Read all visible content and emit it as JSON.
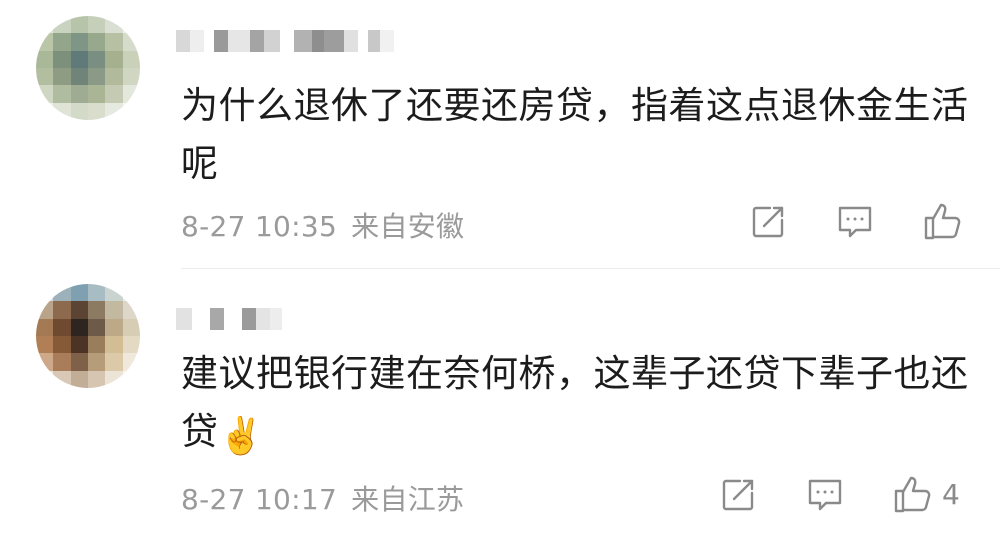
{
  "comments": [
    {
      "text": "为什么退休了还要还房贷，指着这点退休金生活呢",
      "time": "8-27 10:35",
      "location": "来自安徽",
      "like_count": ""
    },
    {
      "text": "建议把银行建在奈何桥，这辈子还贷下辈子也还贷",
      "emoji": "✌️",
      "time": "8-27 10:17",
      "location": "来自江苏",
      "like_count": "4"
    }
  ],
  "icons": {
    "share": "share-icon",
    "comment": "comment-icon",
    "like": "like-icon"
  },
  "colors": {
    "text": "#1c1c1c",
    "meta": "#9a9a9a",
    "icon": "#8a8a8a",
    "divider": "#ececec"
  }
}
